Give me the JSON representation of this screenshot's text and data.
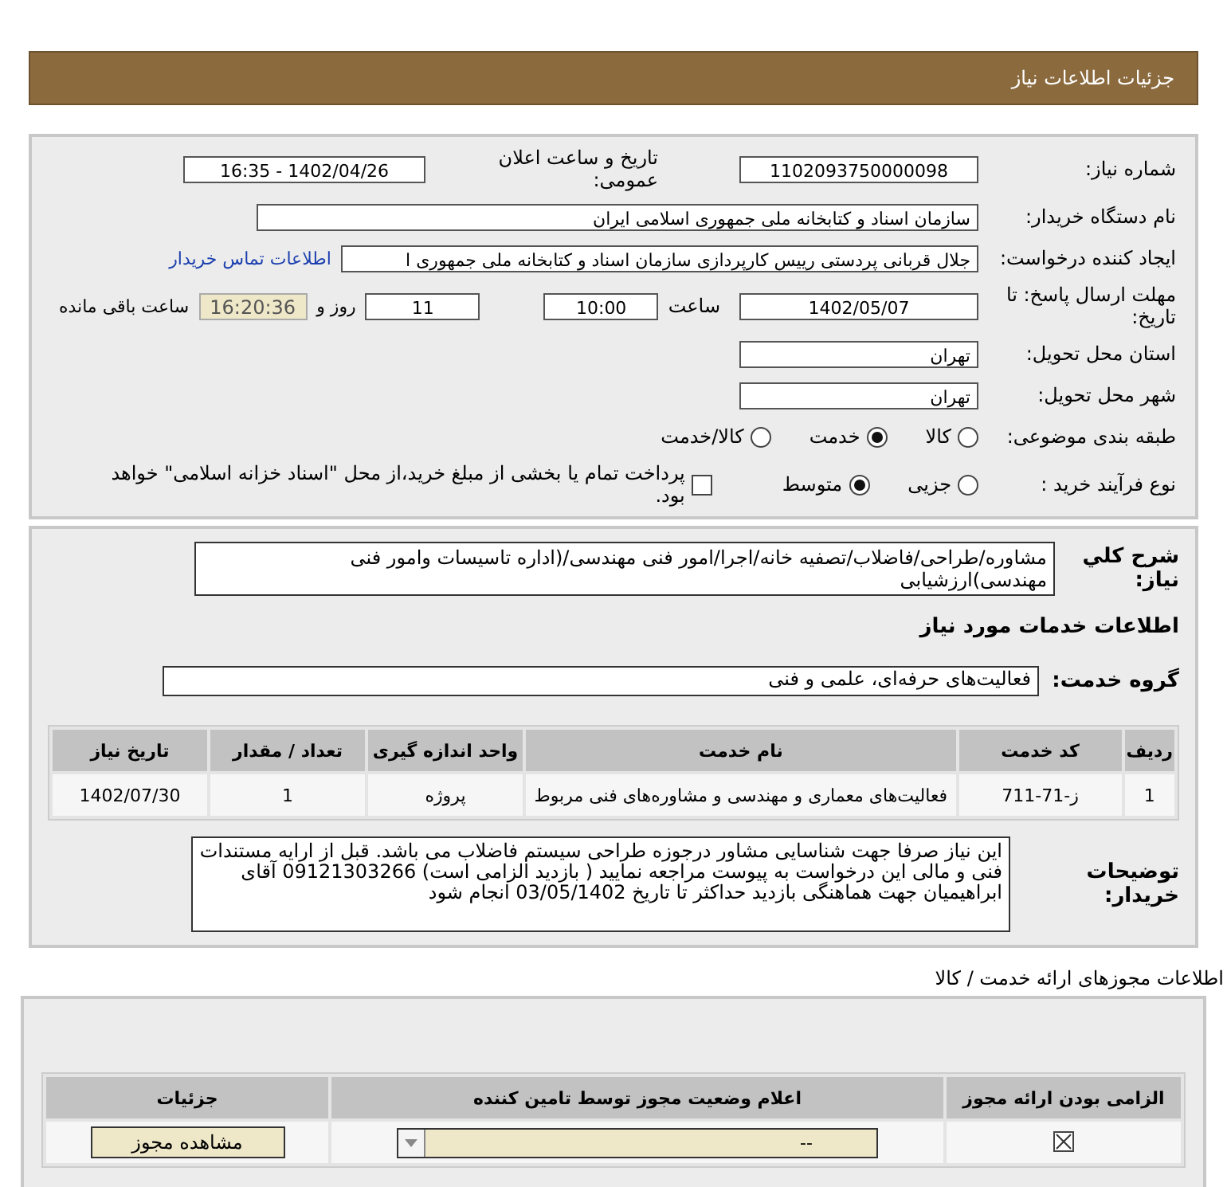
{
  "header": {
    "title": "جزئیات اطلاعات نیاز"
  },
  "need_number": {
    "label": "شماره نیاز:",
    "value": "1102093750000098"
  },
  "announce": {
    "label": "تاریخ و ساعت اعلان عمومی:",
    "value": "1402/04/26 - 16:35"
  },
  "buyer": {
    "label": "نام دستگاه خریدار:",
    "value": "سازمان اسناد و کتابخانه ملی جمهوری اسلامی ایران"
  },
  "requester": {
    "label": "ایجاد کننده درخواست:",
    "value": "جلال قربانی پردستی رییس کارپردازی سازمان اسناد و کتابخانه ملی جمهوری ا",
    "link": "اطلاعات تماس خریدار"
  },
  "deadline": {
    "label": "مهلت ارسال پاسخ: تا تاریخ:",
    "date": "1402/05/07",
    "time_label": "ساعت",
    "time": "10:00",
    "days": "11",
    "days_label": "روز و",
    "remaining": "16:20:36",
    "remaining_label": "ساعت باقی مانده"
  },
  "province": {
    "label": "استان محل تحویل:",
    "value": "تهران"
  },
  "city": {
    "label": "شهر محل تحویل:",
    "value": "تهران"
  },
  "category": {
    "label": "طبقه بندی موضوعی:",
    "options": [
      {
        "label": "کالا",
        "selected": false
      },
      {
        "label": "خدمت",
        "selected": true
      },
      {
        "label": "کالا/خدمت",
        "selected": false
      }
    ]
  },
  "process": {
    "label": "نوع فرآیند خرید :",
    "options": [
      {
        "label": "جزیی",
        "selected": false
      },
      {
        "label": "متوسط",
        "selected": true
      }
    ],
    "payment": {
      "label": "پرداخت تمام یا بخشی از مبلغ خرید،از محل \"اسناد خزانه اسلامی\" خواهد بود.",
      "checked": false
    }
  },
  "description": {
    "label": "شرح کلي نياز:",
    "value": "مشاوره/طراحی/فاضلاب/تصفیه خانه/اجرا/امور فنی مهندسی/(اداره تاسیسات وامور فنی مهندسی)ارزشیابی"
  },
  "services_title": "اطلاعات خدمات مورد نیاز",
  "service_group": {
    "label": "گروه خدمت:",
    "value": "فعالیت‌های حرفه‌ای، علمی و فنی"
  },
  "services_table": {
    "columns": [
      "ردیف",
      "کد خدمت",
      "نام خدمت",
      "واحد اندازه گیری",
      "تعداد / مقدار",
      "تاریخ نیاز"
    ],
    "rows": [
      [
        "1",
        "ز-71-711",
        "فعالیت‌های معماری و مهندسی و مشاوره‌های فنی مربوط",
        "پروژه",
        "1",
        "1402/07/30"
      ]
    ]
  },
  "buyer_notes": {
    "label": "توضیحات خریدار:",
    "value": "این نیاز صرفا جهت شناسایی مشاور درجوزه طراحی سیستم فاضلاب می باشد. قبل از ارایه مستندات فنی و مالی این درخواست به پیوست مراجعه نمایید ( بازدید الزامی است) 09121303266  آقای ابراهیمیان جهت هماهنگی بازدید حداکثر تا تاریخ 03/05/1402 انجام شود"
  },
  "licenses": {
    "title": "اطلاعات مجوزهای ارائه خدمت / کالا",
    "columns": [
      "الزامی بودن ارائه مجوز",
      "اعلام وضعیت مجوز توسط تامین کننده",
      "جزئیات"
    ],
    "rows": [
      {
        "required": true,
        "status": "--",
        "action": "مشاهده مجوز"
      }
    ]
  }
}
